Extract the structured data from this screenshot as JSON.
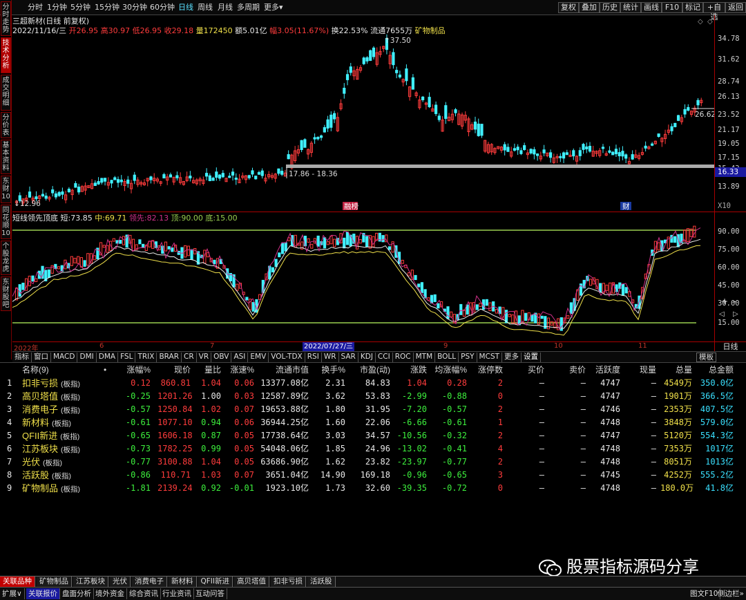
{
  "toolbar": {
    "left_items": [
      "分时",
      "1分钟",
      "5分钟",
      "15分钟",
      "30分钟",
      "60分钟",
      "日线",
      "周线",
      "月线",
      "多周期",
      "更多"
    ],
    "active": "日线",
    "right_items": [
      "复权",
      "叠加",
      "历史",
      "统计",
      "画线",
      "F10",
      "标记",
      "+自选",
      "返回"
    ]
  },
  "side_tabs": [
    "分时走势",
    "技术分析",
    "成交明细",
    "分价表",
    "基本资料",
    "东财10",
    "同花顺10",
    "个股龙虎",
    "东财股吧"
  ],
  "side_active": "技术分析",
  "chart": {
    "title": "三超新材(日线 前复权)",
    "info": {
      "date": "2022/11/16/三",
      "open_label": "开",
      "open": "26.95",
      "high_label": "高",
      "high": "30.97",
      "low_label": "低",
      "low": "26.95",
      "close_label": "收",
      "close": "29.18",
      "vol_label": "量",
      "vol": "172450",
      "amount_label": "额",
      "amount": "5.01亿",
      "range_label": "幅",
      "range": "3.05(11.67%)",
      "turnover_label": "换",
      "turnover": "22.53%",
      "float_label": "流通",
      "float": "7655万",
      "sector": "矿物制品"
    },
    "price_axis": [
      "34.78",
      "31.62",
      "28.74",
      "26.13",
      "23.52",
      "21.17",
      "19.05",
      "17.15",
      "15.43",
      "13.89"
    ],
    "x_multiplier": "X10",
    "highlight_price": "16.33",
    "annotations": {
      "high": "37.50",
      "low": "12.96",
      "band": "17.86 - 18.36",
      "last": "26.62",
      "tag1": "融榜",
      "tag2": "财"
    }
  },
  "indicator": {
    "name": "短线领先顶底",
    "short_label": "短:",
    "short": "73.85",
    "mid_label": "中:",
    "mid": "69.71",
    "lead_label": "领先:",
    "lead": "82.13",
    "top_label": "顶:",
    "top": "90.00",
    "bottom_label": "底:",
    "bottom": "15.00",
    "axis": [
      "90.00",
      "75.00",
      "60.00",
      "45.00",
      "30.00",
      "15.00"
    ]
  },
  "date_axis": {
    "labels": [
      "2022年",
      "6",
      "7",
      "8",
      "9",
      "10",
      "11"
    ],
    "cursor": "2022/07/27/三",
    "side_btn": "日线"
  },
  "indicator_tabs": [
    "指标",
    "窗口",
    "MACD",
    "DMI",
    "DMA",
    "FSL",
    "TRIX",
    "BRAR",
    "CR",
    "VR",
    "OBV",
    "ASI",
    "EMV",
    "VOL-TDX",
    "RSI",
    "WR",
    "SAR",
    "KDJ",
    "CCI",
    "ROC",
    "MTM",
    "BOLL",
    "PSY",
    "MCST",
    "更多",
    "设置"
  ],
  "template_btn": "模板",
  "zoom_plus": "+",
  "zoom_minus": "-",
  "nav_left": "◁",
  "nav_right": "▷",
  "table": {
    "headers": [
      "名称(9)",
      "•",
      "涨幅%",
      "现价",
      "量比",
      "涨速%",
      "流通市值",
      "换手%",
      "市盈(动)",
      "涨跌",
      "均涨幅%",
      "涨停数",
      "买价",
      "卖价",
      "活跃度",
      "现量",
      "总量",
      "总金额"
    ],
    "rows": [
      {
        "idx": "1",
        "name": "扣非亏损",
        "tag": "(板指)",
        "chg": "0.12",
        "price": "860.81",
        "vr": "1.04",
        "spd": "0.06",
        "mcap": "13377.08亿",
        "turn": "2.31",
        "pe": "84.83",
        "diff": "1.04",
        "avg": "0.28",
        "lim": "2",
        "bid": "—",
        "ask": "—",
        "act": "4747",
        "cur": "—",
        "vol": "4549万",
        "amt": "350.0亿"
      },
      {
        "idx": "2",
        "name": "高贝塔值",
        "tag": "(板指)",
        "chg": "-0.25",
        "price": "1201.26",
        "vr": "1.00",
        "spd": "0.03",
        "mcap": "12587.89亿",
        "turn": "3.62",
        "pe": "53.83",
        "diff": "-2.99",
        "avg": "-0.88",
        "lim": "0",
        "bid": "—",
        "ask": "—",
        "act": "4747",
        "cur": "—",
        "vol": "1901万",
        "amt": "366.5亿"
      },
      {
        "idx": "3",
        "name": "消费电子",
        "tag": "(板指)",
        "chg": "-0.57",
        "price": "1250.84",
        "vr": "1.02",
        "spd": "0.07",
        "mcap": "19653.88亿",
        "turn": "1.80",
        "pe": "31.95",
        "diff": "-7.20",
        "avg": "-0.57",
        "lim": "2",
        "bid": "—",
        "ask": "—",
        "act": "4746",
        "cur": "—",
        "vol": "2353万",
        "amt": "407.5亿"
      },
      {
        "idx": "4",
        "name": "新材料",
        "tag": "(板指)",
        "chg": "-0.61",
        "price": "1077.10",
        "vr": "0.94",
        "spd": "0.06",
        "mcap": "36944.25亿",
        "turn": "1.60",
        "pe": "22.06",
        "diff": "-6.66",
        "avg": "-0.61",
        "lim": "1",
        "bid": "—",
        "ask": "—",
        "act": "4748",
        "cur": "—",
        "vol": "3848万",
        "amt": "579.0亿"
      },
      {
        "idx": "5",
        "name": "QFII新进",
        "tag": "(板指)",
        "chg": "-0.65",
        "price": "1606.18",
        "vr": "0.87",
        "spd": "0.05",
        "mcap": "17738.64亿",
        "turn": "3.03",
        "pe": "34.57",
        "diff": "-10.56",
        "avg": "-0.32",
        "lim": "2",
        "bid": "—",
        "ask": "—",
        "act": "4747",
        "cur": "—",
        "vol": "5120万",
        "amt": "554.3亿"
      },
      {
        "idx": "6",
        "name": "江苏板块",
        "tag": "(板指)",
        "chg": "-0.73",
        "price": "1782.25",
        "vr": "0.99",
        "spd": "0.05",
        "mcap": "54048.06亿",
        "turn": "1.85",
        "pe": "24.96",
        "diff": "-13.02",
        "avg": "-0.41",
        "lim": "4",
        "bid": "—",
        "ask": "—",
        "act": "4748",
        "cur": "—",
        "vol": "7353万",
        "amt": "1017亿"
      },
      {
        "idx": "7",
        "name": "光伏",
        "tag": "(板指)",
        "chg": "-0.77",
        "price": "3100.88",
        "vr": "1.04",
        "spd": "0.05",
        "mcap": "63686.90亿",
        "turn": "1.62",
        "pe": "23.82",
        "diff": "-23.97",
        "avg": "-0.77",
        "lim": "2",
        "bid": "—",
        "ask": "—",
        "act": "4748",
        "cur": "—",
        "vol": "8051万",
        "amt": "1013亿"
      },
      {
        "idx": "8",
        "name": "活跃股",
        "tag": "(板指)",
        "chg": "-0.86",
        "price": "110.71",
        "vr": "1.03",
        "spd": "0.07",
        "mcap": "3651.04亿",
        "turn": "14.90",
        "pe": "169.18",
        "diff": "-0.96",
        "avg": "-0.65",
        "lim": "3",
        "bid": "—",
        "ask": "—",
        "act": "4745",
        "cur": "—",
        "vol": "4252万",
        "amt": "555.2亿"
      },
      {
        "idx": "9",
        "name": "矿物制品",
        "tag": "(板指)",
        "chg": "-1.81",
        "price": "2139.24",
        "vr": "0.92",
        "spd": "-0.01",
        "mcap": "1923.10亿",
        "turn": "1.73",
        "pe": "32.60",
        "diff": "-39.35",
        "avg": "-0.72",
        "lim": "0",
        "bid": "—",
        "ask": "—",
        "act": "4748",
        "cur": "—",
        "vol": "180.0万",
        "amt": "41.8亿"
      }
    ]
  },
  "bottom_tabs": [
    "关联品种",
    "矿物制品",
    "江苏板块",
    "光伏",
    "消费电子",
    "新材料",
    "QFII新进",
    "高贝塔值",
    "扣非亏损",
    "活跃股"
  ],
  "bottom_active": "关联品种",
  "status": [
    "扩展∨",
    "关联报价",
    "盘面分析",
    "境外资金",
    "综合资讯",
    "行业资讯",
    "互动问答"
  ],
  "status_right": [
    "图文F10",
    "侧边栏»"
  ],
  "watermark": "股票指标源码分享",
  "colors": {
    "up": "#ff3c3c",
    "down": "#40f0ff",
    "grid": "#aa0000",
    "line_yellow": "#f0e04a",
    "line_white": "#e8e8e8",
    "line_magenta": "#d0308a",
    "level": "#9ad050"
  }
}
